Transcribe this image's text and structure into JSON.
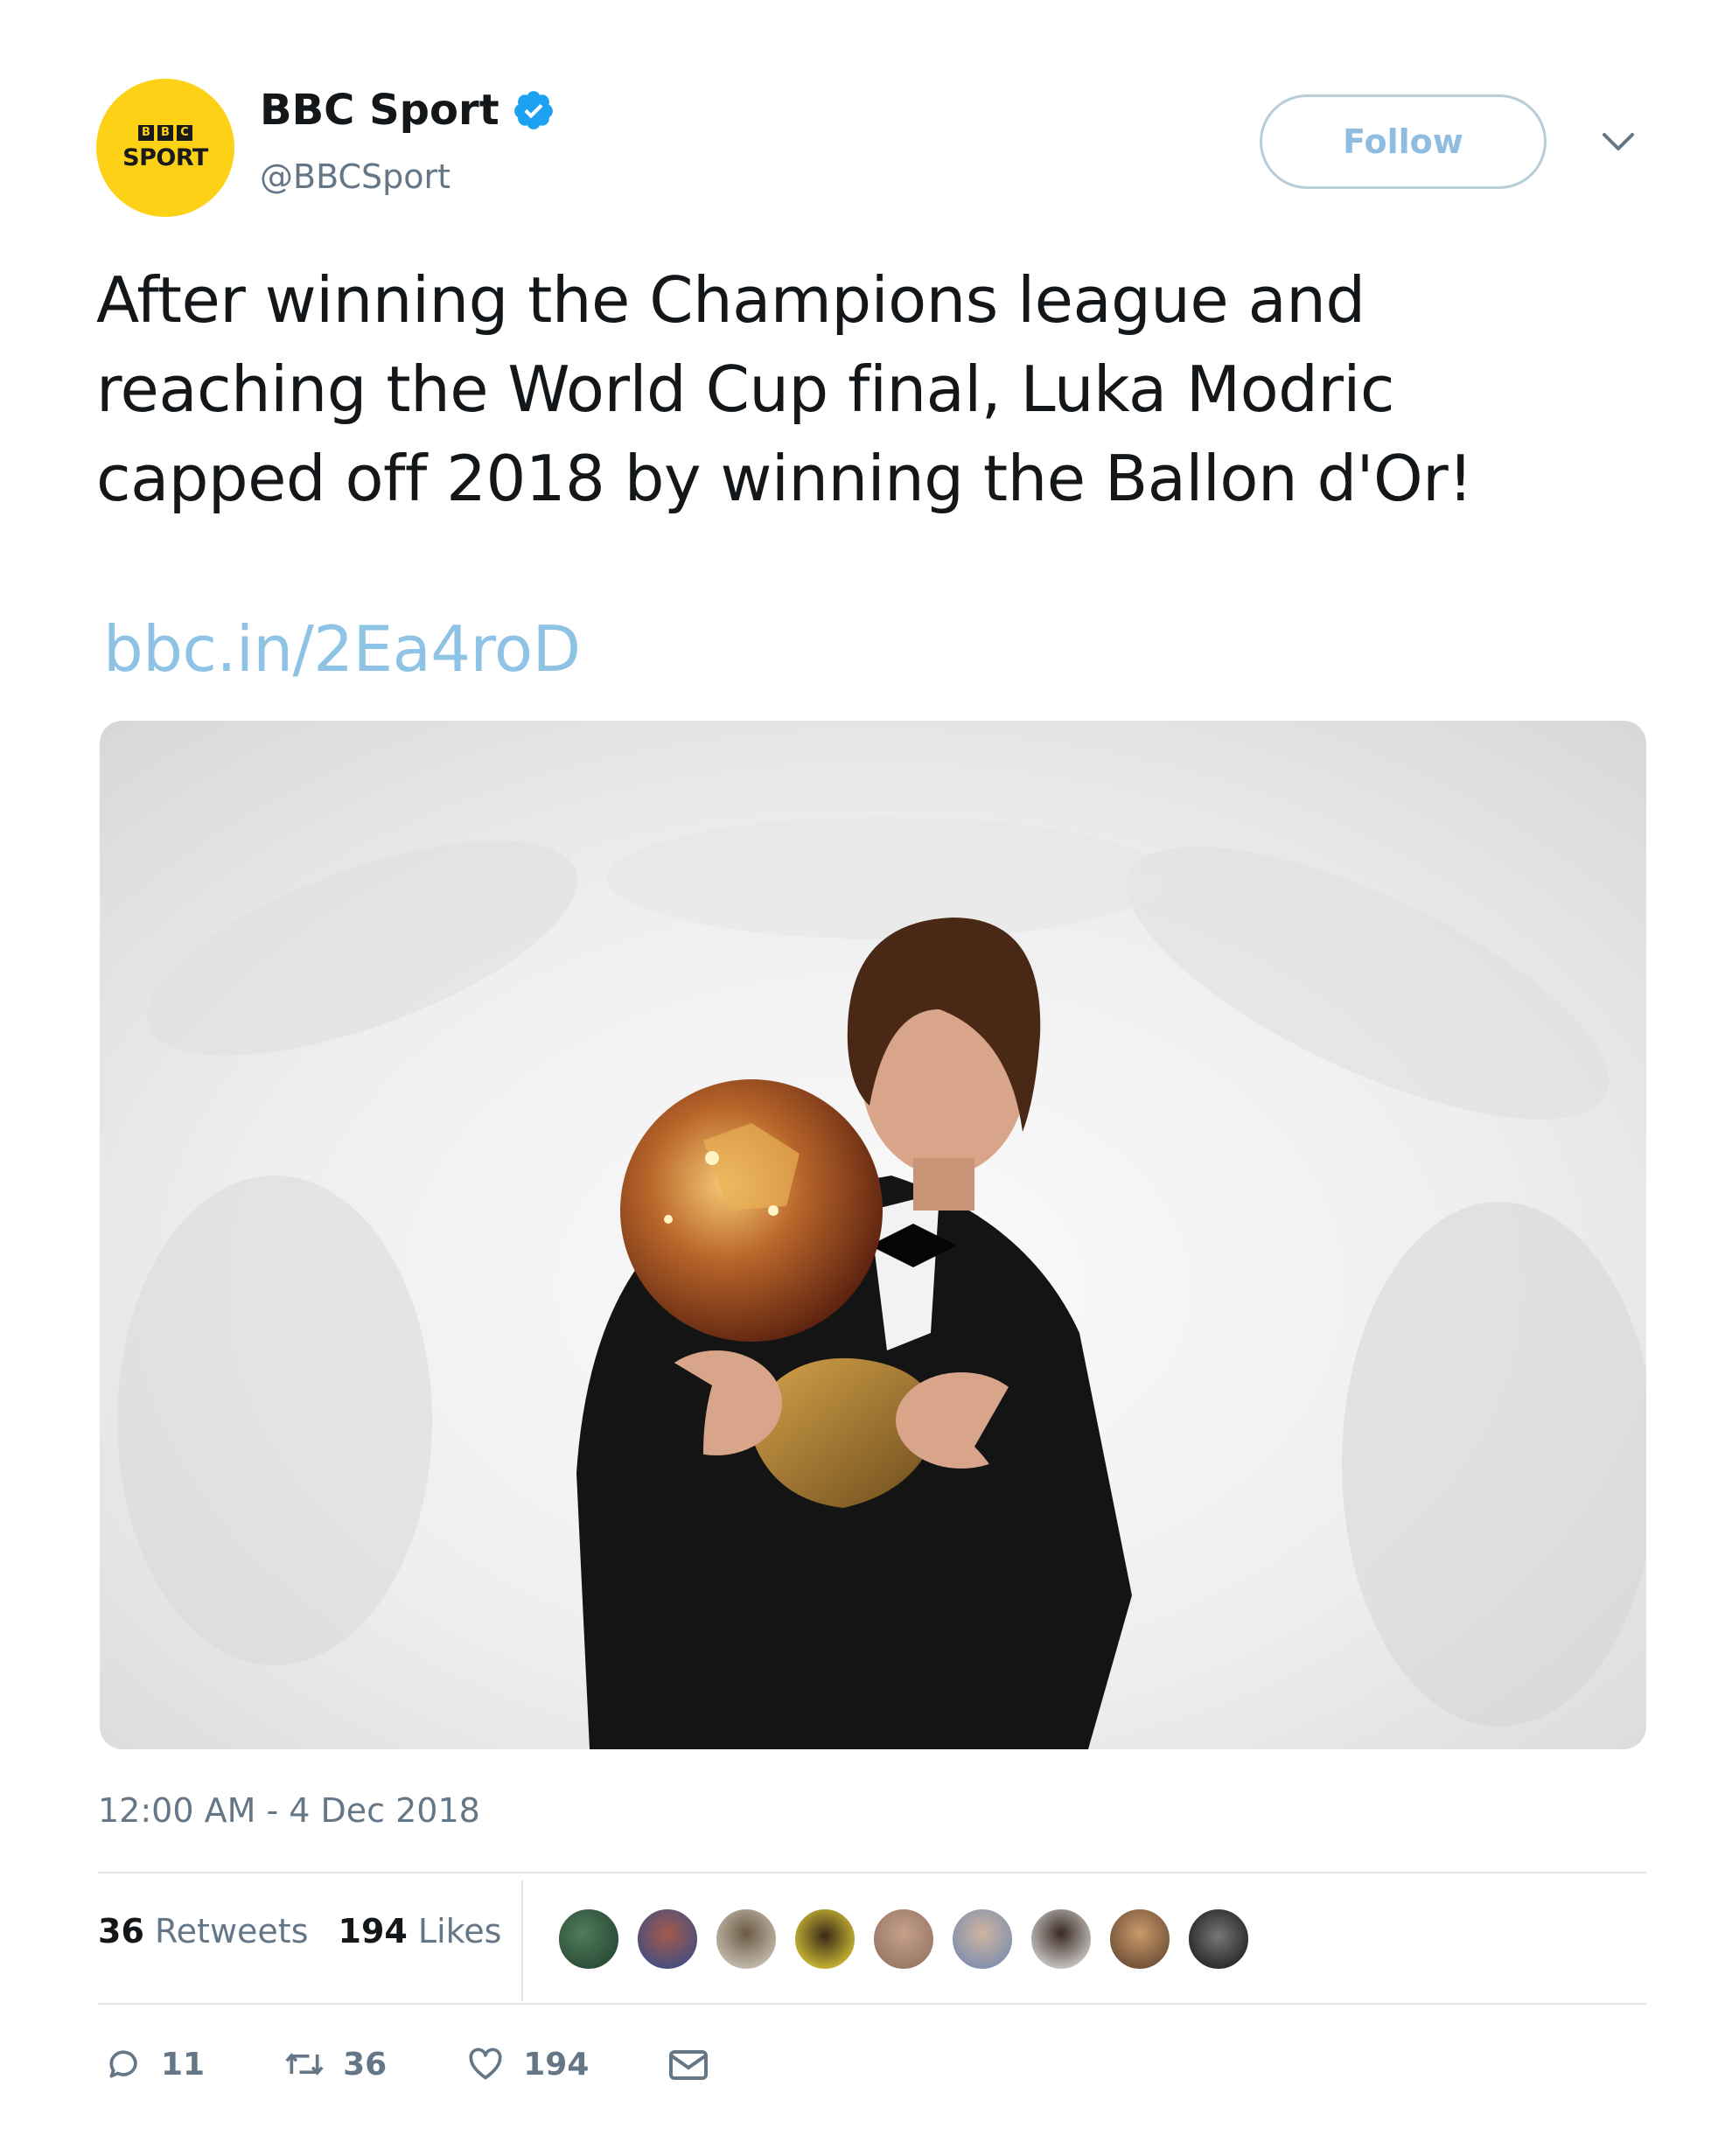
{
  "account": {
    "avatar_label_top": "BBC",
    "avatar_label": "SPORT",
    "display_name": "BBC Sport",
    "handle": "@BBCSport",
    "verified": true
  },
  "follow_button": {
    "label": "Follow"
  },
  "tweet": {
    "text": "After winning the Champions league and reaching the World Cup final, Luka Modric capped off 2018 by winning the Ballon d'Or!",
    "link": "bbc.in/2Ea4roD",
    "timestamp": "12:00 AM - 4 Dec 2018"
  },
  "stats": {
    "retweets_count": "36",
    "retweets_label": "Retweets",
    "likes_count": "194",
    "likes_label": "Likes"
  },
  "actions": {
    "reply_count": "11",
    "retweet_count": "36",
    "like_count": "194"
  },
  "colors": {
    "avatar": "#fcd116",
    "verified": "#1da1f2",
    "link": "#8fc3e5",
    "follow_text": "#8fbde2",
    "secondary_text": "#657786"
  },
  "icons": {
    "reply": "reply-icon",
    "retweet": "retweet-icon",
    "like": "heart-icon",
    "message": "envelope-icon",
    "caret": "chevron-down-icon",
    "verified": "verified-badge-icon"
  }
}
